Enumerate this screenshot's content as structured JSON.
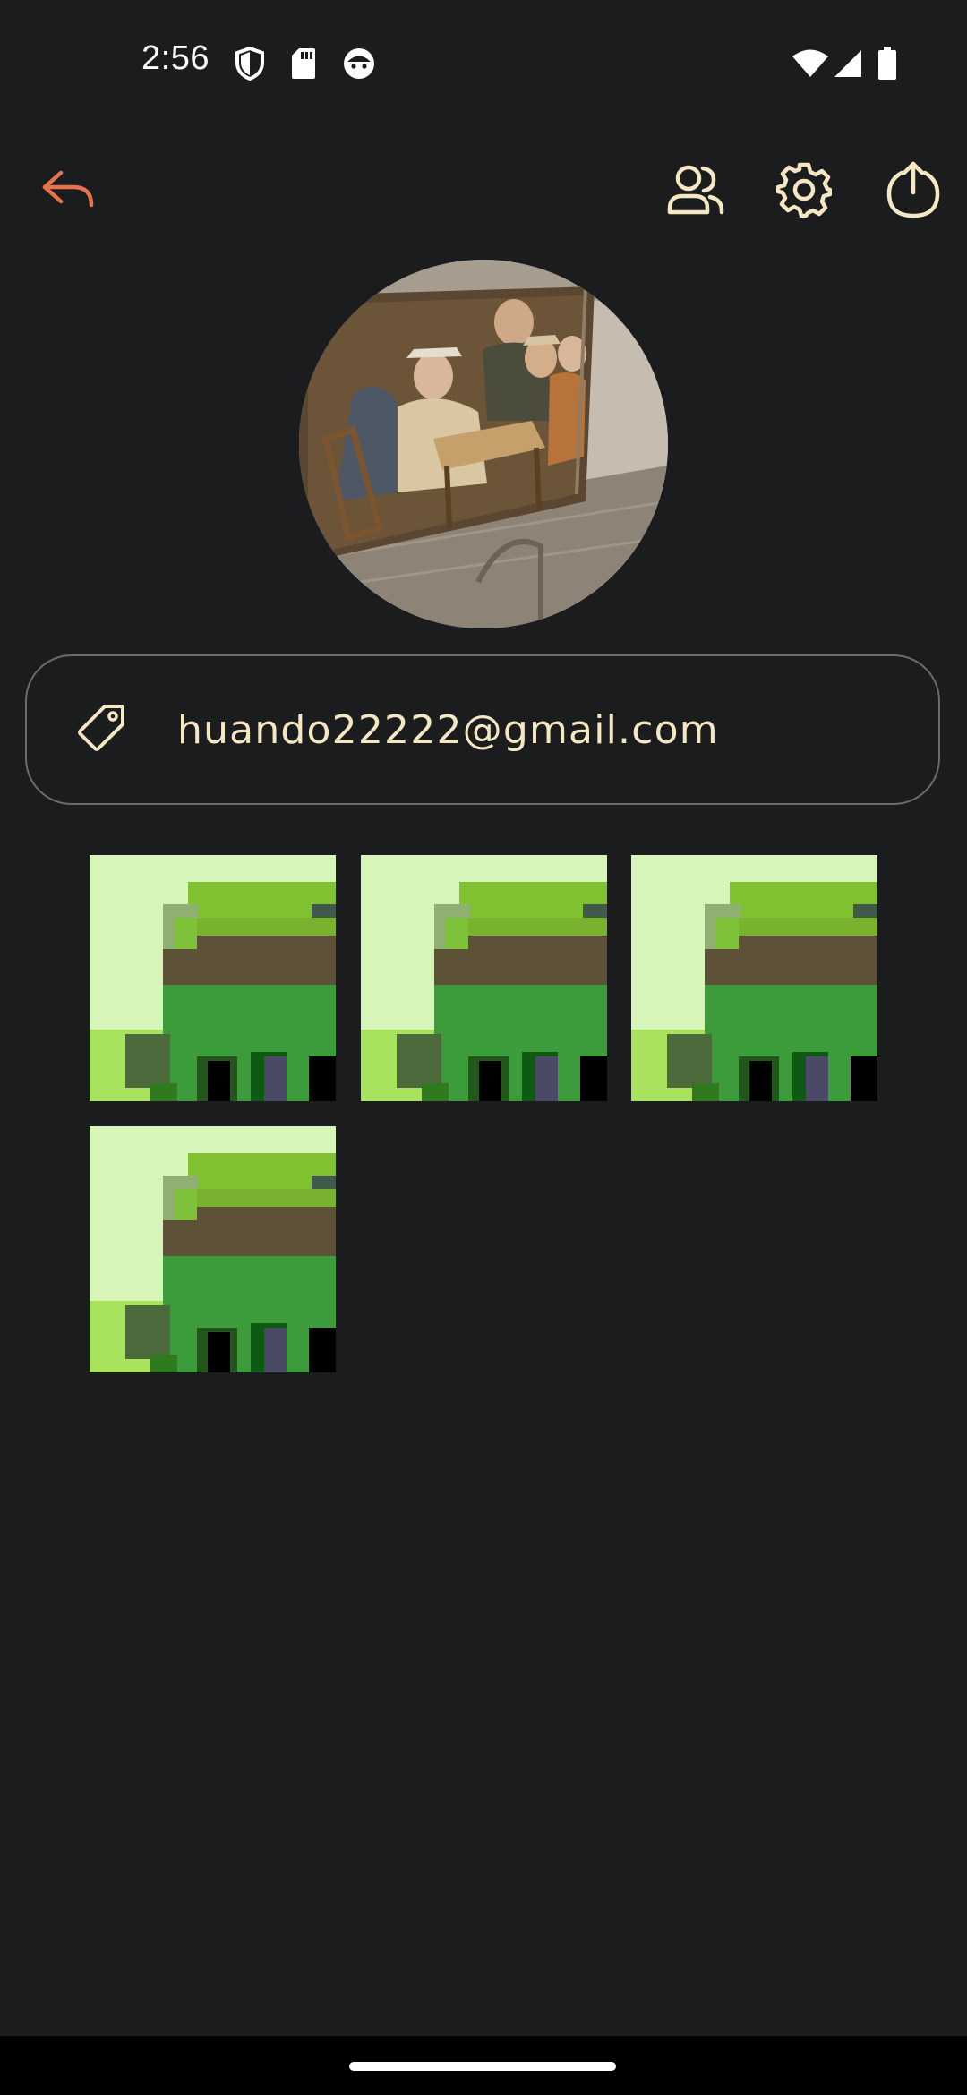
{
  "status_bar": {
    "time": "2:56",
    "left_icons": [
      "shield-icon",
      "sd-card-icon",
      "face-icon"
    ],
    "right_icons": [
      "wifi-icon",
      "signal-icon",
      "battery-icon"
    ]
  },
  "toolbar": {
    "icons": [
      "back-icon",
      "friends-icon",
      "settings-icon",
      "logout-icon"
    ],
    "accent_color": "#e8734a",
    "icon_color": "#f5e7c2"
  },
  "profile": {
    "avatar": "painting-photo",
    "tag_icon": "tag-icon",
    "email": "huando22222@gmail.com"
  },
  "gallery": {
    "tile_count": 4,
    "tile_image": "pixel-house"
  }
}
